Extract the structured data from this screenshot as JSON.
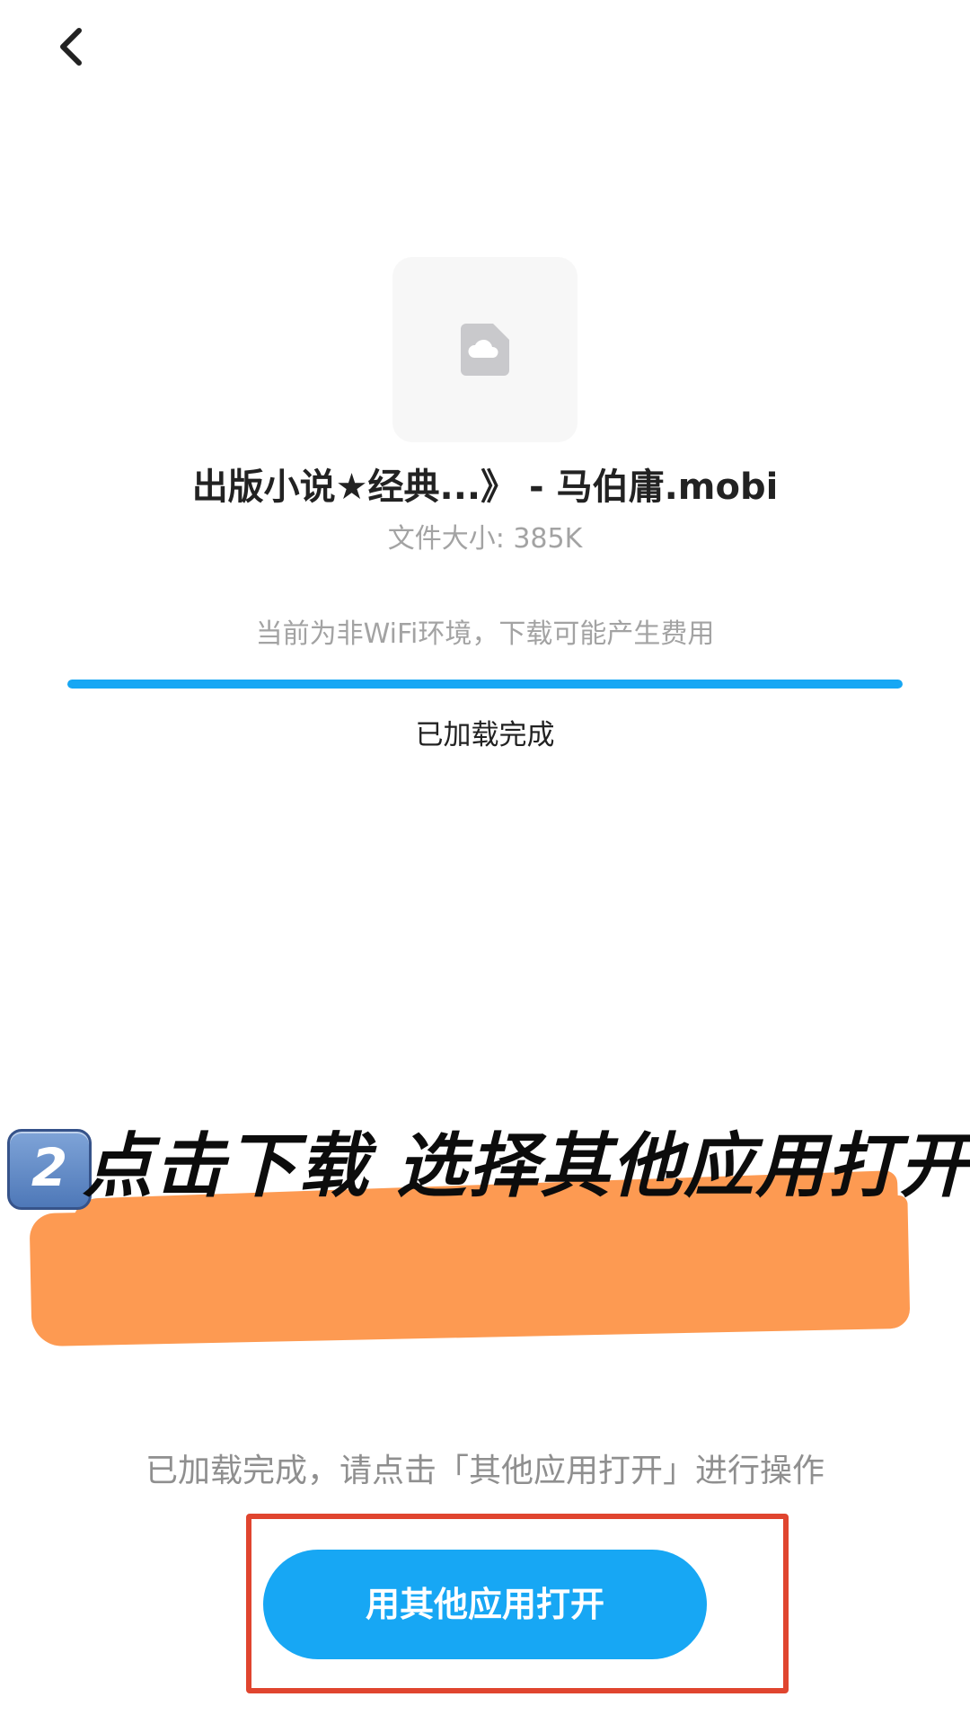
{
  "header": {
    "back_icon": "chevron-left-icon"
  },
  "file": {
    "icon": "cloud-file-icon",
    "name": "出版小说★经典...》 - 马伯庸.mobi",
    "size_text": "文件大小: 385K"
  },
  "download": {
    "network_tip": "当前为非WiFi环境，下载可能产生费用",
    "progress": 1.0,
    "status": "已加载完成"
  },
  "annotation": {
    "badge": "2",
    "text": "点击下载 选择其他应用打开"
  },
  "footer": {
    "instruction": "已加载完成，请点击「其他应用打开」进行操作",
    "open_button_label": "用其他应用打开"
  },
  "colors": {
    "accent": "#17a7f4",
    "highlight_red": "#e0452f",
    "marker_orange": "#fd9a52"
  }
}
